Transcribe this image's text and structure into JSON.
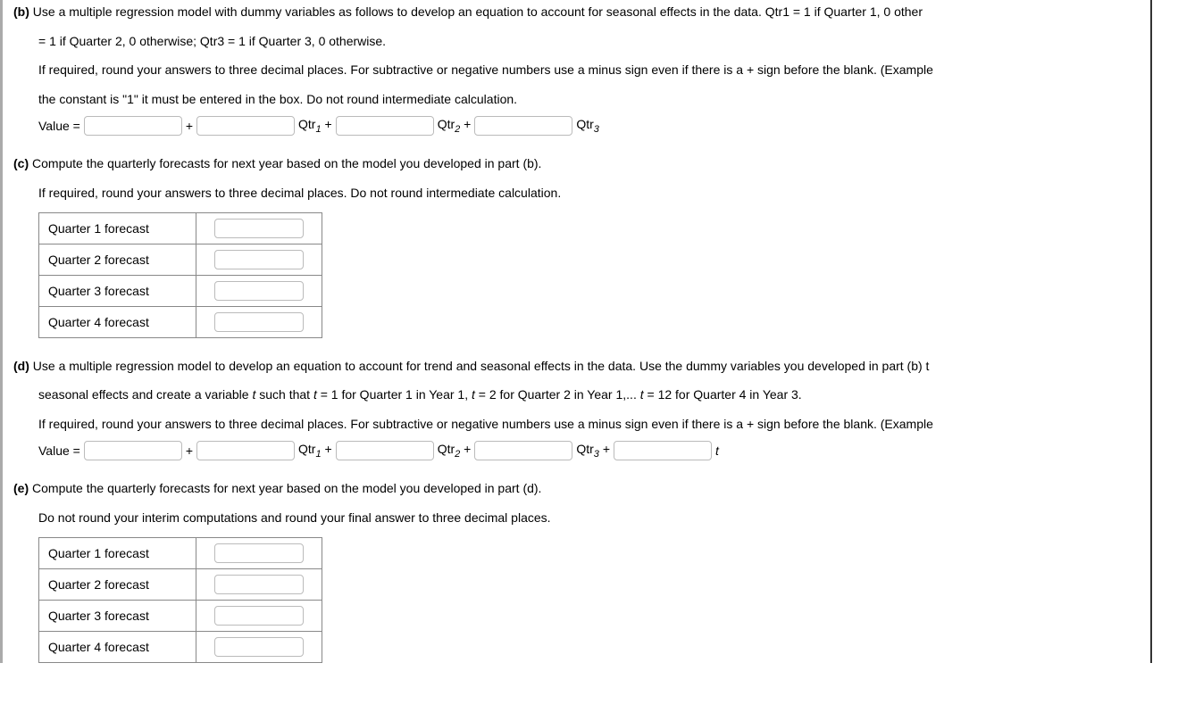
{
  "b": {
    "label": "(b)",
    "prompt1": "Use a multiple regression model with dummy variables as follows to develop an equation to account for seasonal effects in the data. Qtr1 = 1 if Quarter 1, 0 other",
    "prompt1b": "= 1 if Quarter 2, 0 otherwise; Qtr3 = 1 if Quarter 3, 0 otherwise.",
    "prompt2": "If required, round your answers to three decimal places. For subtractive or negative numbers use a minus sign even if there is a + sign before the blank. (Example",
    "prompt2b": "the constant is \"1\" it must be entered in the box. Do not round intermediate calculation.",
    "eq": {
      "lhs": "Value =",
      "plus": "+",
      "qtr1": "Qtr",
      "qtr1sub": "1",
      "qtr2": "Qtr",
      "qtr2sub": "2",
      "qtr3": "Qtr",
      "qtr3sub": "3"
    }
  },
  "c": {
    "label": "(c)",
    "prompt1": "Compute the quarterly forecasts for next year based on the model you developed in part (b).",
    "prompt2": "If required, round your answers to three decimal places. Do not round intermediate calculation.",
    "rows": [
      "Quarter 1 forecast",
      "Quarter 2 forecast",
      "Quarter 3 forecast",
      "Quarter 4 forecast"
    ]
  },
  "d": {
    "label": "(d)",
    "prompt1a": "Use a multiple regression model to develop an equation to account for trend and seasonal effects in the data. Use the dummy variables you developed in part (b) t",
    "prompt1b_pre": "seasonal effects and create a variable ",
    "prompt1b_t": "t",
    "prompt1b_mid1": " such that ",
    "prompt1b_t2": "t",
    "prompt1b_mid2": " = 1 for Quarter 1 in Year 1, ",
    "prompt1b_t3": "t",
    "prompt1b_mid3": " = 2 for Quarter 2 in Year 1,... ",
    "prompt1b_t4": "t",
    "prompt1b_end": " = 12 for Quarter 4 in Year 3.",
    "prompt2": "If required, round your answers to three decimal places. For subtractive or negative numbers use a minus sign even if there is a + sign before the blank. (Example",
    "eq": {
      "lhs": "Value =",
      "plus": "+",
      "qtr1": "Qtr",
      "qtr1sub": "1",
      "qtr2": "Qtr",
      "qtr2sub": "2",
      "qtr3": "Qtr",
      "qtr3sub": "3",
      "t": "t"
    }
  },
  "e": {
    "label": "(e)",
    "prompt1": "Compute the quarterly forecasts for next year based on the model you developed in part (d).",
    "prompt2": "Do not round your interim computations and round your final answer to three decimal places.",
    "rows": [
      "Quarter 1 forecast",
      "Quarter 2 forecast",
      "Quarter 3 forecast",
      "Quarter 4 forecast"
    ]
  }
}
